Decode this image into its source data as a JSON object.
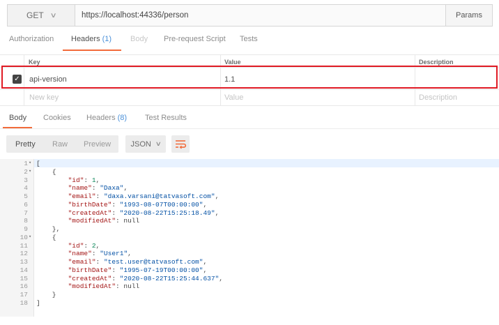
{
  "request": {
    "method": "GET",
    "url": "https://localhost:44336/person",
    "params_label": "Params"
  },
  "request_tabs": [
    {
      "label": "Authorization",
      "count": ""
    },
    {
      "label": "Headers",
      "count": "(1)"
    },
    {
      "label": "Body",
      "count": ""
    },
    {
      "label": "Pre-request Script",
      "count": ""
    },
    {
      "label": "Tests",
      "count": ""
    }
  ],
  "headers_table": {
    "columns": [
      "Key",
      "Value",
      "Description"
    ],
    "rows": [
      {
        "key": "api-version",
        "value": "1.1",
        "description": "",
        "checked": true
      }
    ],
    "placeholders": {
      "key": "New key",
      "value": "Value",
      "description": "Description"
    }
  },
  "response_tabs": [
    {
      "label": "Body",
      "count": ""
    },
    {
      "label": "Cookies",
      "count": ""
    },
    {
      "label": "Headers",
      "count": "(8)"
    },
    {
      "label": "Test Results",
      "count": ""
    }
  ],
  "view_modes": [
    "Pretty",
    "Raw",
    "Preview"
  ],
  "format": "JSON",
  "colors": {
    "accent": "#f26b3a",
    "highlight_border": "#e01a24",
    "count": "#4a90d9"
  },
  "response_lines": [
    {
      "n": "1",
      "fold": true,
      "text": "["
    },
    {
      "n": "2",
      "fold": true,
      "text": "    {"
    },
    {
      "n": "3",
      "fold": false,
      "text": "        \"id\": 1,"
    },
    {
      "n": "4",
      "fold": false,
      "text": "        \"name\": \"Daxa\","
    },
    {
      "n": "5",
      "fold": false,
      "text": "        \"email\": \"daxa.varsani@tatvasoft.com\","
    },
    {
      "n": "6",
      "fold": false,
      "text": "        \"birthDate\": \"1993-08-07T00:00:00\","
    },
    {
      "n": "7",
      "fold": false,
      "text": "        \"createdAt\": \"2020-08-22T15:25:18.49\","
    },
    {
      "n": "8",
      "fold": false,
      "text": "        \"modifiedAt\": null"
    },
    {
      "n": "9",
      "fold": false,
      "text": "    },"
    },
    {
      "n": "10",
      "fold": true,
      "text": "    {"
    },
    {
      "n": "11",
      "fold": false,
      "text": "        \"id\": 2,"
    },
    {
      "n": "12",
      "fold": false,
      "text": "        \"name\": \"User1\","
    },
    {
      "n": "13",
      "fold": false,
      "text": "        \"email\": \"test.user@tatvasoft.com\","
    },
    {
      "n": "14",
      "fold": false,
      "text": "        \"birthDate\": \"1995-07-19T00:00:00\","
    },
    {
      "n": "15",
      "fold": false,
      "text": "        \"createdAt\": \"2020-08-22T15:25:44.637\","
    },
    {
      "n": "16",
      "fold": false,
      "text": "        \"modifiedAt\": null"
    },
    {
      "n": "17",
      "fold": false,
      "text": "    }"
    },
    {
      "n": "18",
      "fold": false,
      "text": "]"
    }
  ]
}
